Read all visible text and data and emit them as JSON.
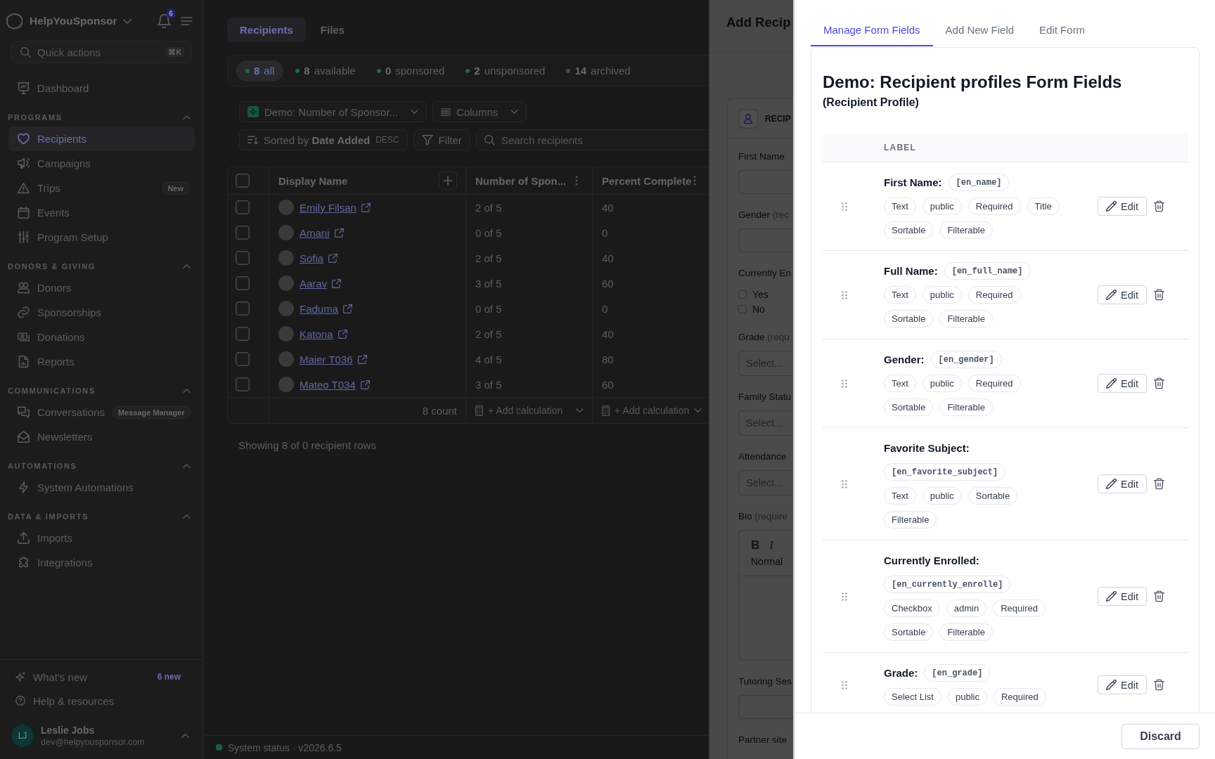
{
  "sidebar": {
    "brand": "HelpYouSponsor",
    "notification_count": "6",
    "quick_actions": {
      "placeholder": "Quick actions",
      "shortcut": "⌘K"
    },
    "items": [
      {
        "label": "Dashboard",
        "selected": false
      }
    ],
    "sections": [
      {
        "title": "PROGRAMS",
        "expanded": true,
        "items": [
          {
            "label": "Recipients",
            "selected": true
          },
          {
            "label": "Campaigns",
            "selected": false
          },
          {
            "label": "Trips",
            "selected": false,
            "badge": "New"
          },
          {
            "label": "Events",
            "selected": false
          },
          {
            "label": "Program Setup",
            "selected": false
          }
        ]
      },
      {
        "title": "DONORS & GIVING",
        "expanded": true,
        "items": [
          {
            "label": "Donors",
            "selected": false
          },
          {
            "label": "Sponsorships",
            "selected": false
          },
          {
            "label": "Donations",
            "selected": false
          },
          {
            "label": "Reports",
            "selected": false
          }
        ]
      },
      {
        "title": "COMMUNICATIONS",
        "expanded": true,
        "items": [
          {
            "label": "Conversations",
            "selected": false,
            "badge": "Message Manager"
          },
          {
            "label": "Newsletters",
            "selected": false
          }
        ]
      },
      {
        "title": "AUTOMATIONS",
        "expanded": true,
        "items": [
          {
            "label": "System Automations",
            "selected": false
          }
        ]
      },
      {
        "title": "DATA & IMPORTS",
        "expanded": true,
        "items": [
          {
            "label": "Imports",
            "selected": false
          },
          {
            "label": "Integrations",
            "selected": false
          }
        ]
      }
    ],
    "footer_items": [
      {
        "label": "What's new",
        "badge": "6 new"
      },
      {
        "label": "Help & resources"
      }
    ],
    "user": {
      "initials": "LJ",
      "name": "Leslie Jobs",
      "email": "dev@helpyousponsor.com"
    }
  },
  "main": {
    "tabs": [
      {
        "label": "Recipients",
        "selected": true
      },
      {
        "label": "Files",
        "selected": false
      }
    ],
    "status_filters": [
      {
        "count": "8",
        "label": "all",
        "selected": true,
        "color": "#1e6a45"
      },
      {
        "count": "8",
        "label": "available",
        "selected": false,
        "color": "#1e6a45"
      },
      {
        "count": "0",
        "label": "sponsored",
        "selected": false,
        "color": "#1e6a45"
      },
      {
        "count": "2",
        "label": "unsponsored",
        "selected": false,
        "color": "#1e6a45"
      },
      {
        "count": "14",
        "label": "archived",
        "selected": false,
        "color": "#4a4a4a"
      }
    ],
    "view_select": "Demo: Number of Sponsor...",
    "columns_button": "Columns",
    "sort": {
      "label": "Sorted by",
      "field": "Date Added",
      "direction": "DESC"
    },
    "filter_button": "Filter",
    "search": {
      "placeholder": "Search recipients"
    },
    "table": {
      "all_checked": false,
      "columns": [
        "Display Name",
        "Number of Spon...",
        "Percent Complete"
      ],
      "rows": [
        {
          "checked": false,
          "name": "Emily Filsan",
          "sponsors": "2 of 5",
          "percent": "40"
        },
        {
          "checked": false,
          "name": "Amani",
          "sponsors": "0 of 5",
          "percent": "0"
        },
        {
          "checked": false,
          "name": "Sofia",
          "sponsors": "2 of 5",
          "percent": "40"
        },
        {
          "checked": false,
          "name": "Aarav",
          "sponsors": "3 of 5",
          "percent": "60"
        },
        {
          "checked": false,
          "name": "Faduma",
          "sponsors": "0 of 5",
          "percent": "0"
        },
        {
          "checked": false,
          "name": "Katona",
          "sponsors": "2 of 5",
          "percent": "40"
        },
        {
          "checked": false,
          "name": "Maier T036",
          "sponsors": "4 of 5",
          "percent": "80"
        },
        {
          "checked": false,
          "name": "Mateo T034",
          "sponsors": "3 of 5",
          "percent": "60"
        }
      ],
      "footer": {
        "count": "8 count",
        "calculations": [
          "+ Add calculation",
          "+ Add calculation"
        ]
      }
    },
    "summary": "Showing 8 of 0 recipient rows",
    "system_status": "System status · v2026.6.5"
  },
  "dialog": {
    "title": "Add Recip",
    "section": "RECIP",
    "fields": [
      {
        "kind": "text",
        "label": "First Name"
      },
      {
        "kind": "text",
        "label": "Gender",
        "hint": "(rec"
      },
      {
        "kind": "checkboxes",
        "label": "Currently En",
        "options": [
          {
            "label": "Yes",
            "checked": false
          },
          {
            "label": "No",
            "checked": false
          }
        ]
      },
      {
        "kind": "select",
        "label": "Grade",
        "hint": "(requ",
        "placeholder": "Select..."
      },
      {
        "kind": "select",
        "label": "Family Statu",
        "placeholder": "Select..."
      },
      {
        "kind": "select",
        "label": "Attendance",
        "placeholder": "Select..."
      },
      {
        "kind": "editor",
        "label": "Bio",
        "hint": "(require",
        "toolbar": [
          {
            "kind": "bold",
            "label": "B"
          },
          {
            "kind": "italic",
            "label": "I"
          }
        ],
        "block_style": "Normal"
      },
      {
        "kind": "text",
        "label": "Tutoring Ses"
      },
      {
        "kind": "label",
        "label": "Partner site"
      }
    ]
  },
  "drawer": {
    "tabs": [
      {
        "label": "Manage Form Fields",
        "selected": true
      },
      {
        "label": "Add New Field",
        "selected": false
      },
      {
        "label": "Edit Form",
        "selected": false
      }
    ],
    "title": "Demo: Recipient profiles Form Fields",
    "subtitle": "(Recipient Profile)",
    "columns": [
      "LABEL"
    ],
    "fields": [
      {
        "label": "First Name:",
        "key": "[en_name]",
        "tags": [
          "Text",
          "public",
          "Required",
          "Title",
          "Sortable",
          "Filterable"
        ],
        "edit": "Edit"
      },
      {
        "label": "Full Name:",
        "key": "[en_full_name]",
        "tags": [
          "Text",
          "public",
          "Required",
          "Sortable",
          "Filterable"
        ],
        "edit": "Edit"
      },
      {
        "label": "Gender:",
        "key": "[en_gender]",
        "tags": [
          "Text",
          "public",
          "Required",
          "Sortable",
          "Filterable"
        ],
        "edit": "Edit"
      },
      {
        "label": "Favorite Subject:",
        "key": "[en_favorite_subject]",
        "tags": [
          "Text",
          "public",
          "Sortable",
          "Filterable"
        ],
        "edit": "Edit"
      },
      {
        "label": "Currently Enrolled:",
        "key": "[en_currently_enrolle]",
        "tags": [
          "Checkbox",
          "admin",
          "Required",
          "Sortable",
          "Filterable"
        ],
        "edit": "Edit"
      },
      {
        "label": "Grade:",
        "key": "[en_grade]",
        "tags": [
          "Select List",
          "public",
          "Required"
        ],
        "edit": "Edit"
      }
    ],
    "discard": "Discard"
  }
}
